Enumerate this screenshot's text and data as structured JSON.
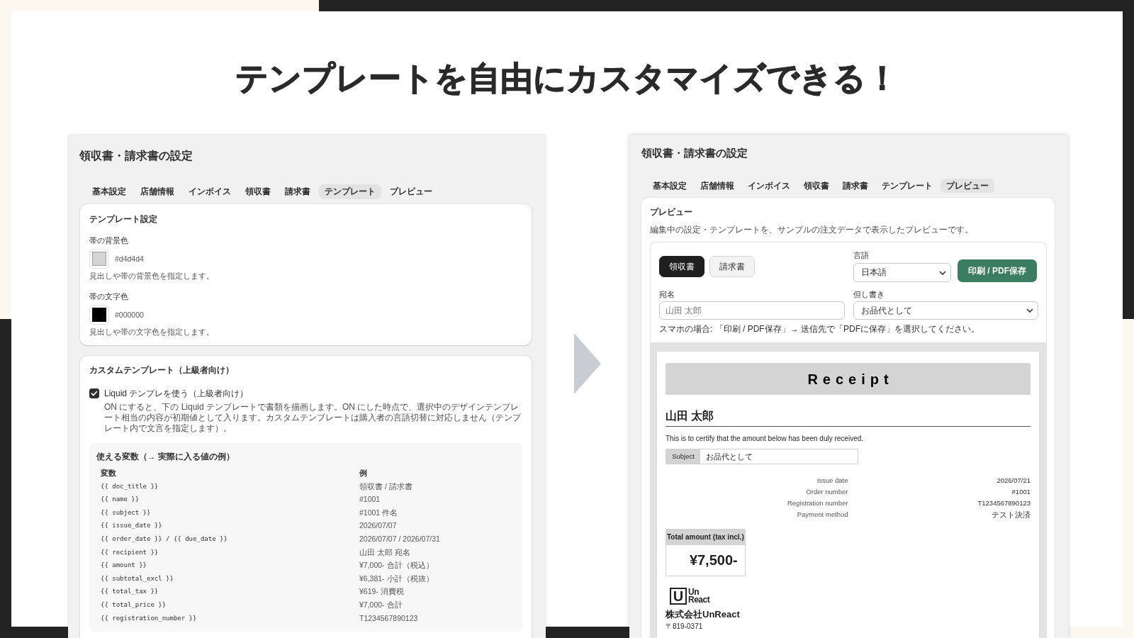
{
  "headline": "テンプレートを自由にカスタマイズできる！",
  "settings_screen": {
    "title": "領収書・請求書の設定",
    "tabs": [
      {
        "label": "基本設定",
        "selected": false
      },
      {
        "label": "店舗情報",
        "selected": false
      },
      {
        "label": "インボイス",
        "selected": false
      },
      {
        "label": "領収書",
        "selected": false
      },
      {
        "label": "請求書",
        "selected": false
      },
      {
        "label": "テンプレート",
        "selected": true
      },
      {
        "label": "プレビュー",
        "selected": false
      }
    ],
    "template_settings": {
      "title": "テンプレート設定",
      "colors": [
        {
          "label": "帯の背景色",
          "value": "#d4d4d4",
          "color": "#d4d4d4",
          "help": "見出しや帯の背景色を指定します。"
        },
        {
          "label": "帯の文字色",
          "value": "#000000",
          "color": "#000000",
          "help": "見出しや帯の文字色を指定します。"
        }
      ]
    },
    "custom_template": {
      "title": "カスタムテンプレート（上級者向け）",
      "checkbox": {
        "label": "Liquid テンプレを使う（上級者向け）",
        "checked": true
      },
      "description": "ON にすると、下の Liquid テンプレートで書類を描画します。ON にした時点で、選択中のデザインテンプレート相当の内容が初期値として入ります。カスタムテンプレートは購入者の言語切替に対応しません（テンプレート内で文言を指定します）。",
      "variables": {
        "title": "使える変数（→ 実際に入る値の例）",
        "columns": [
          "変数",
          "例"
        ],
        "rows": [
          {
            "variable": "{{ doc_title }}",
            "example": "領収書 / 請求書"
          },
          {
            "variable": "{{ name }}",
            "example": "#1001"
          },
          {
            "variable": "{{ subject }}",
            "example": "#1001 件名"
          },
          {
            "variable": "{{ issue_date }}",
            "example": "2026/07/07"
          },
          {
            "variable": "{{ order_date }} / {{ due_date }}",
            "example": "2026/07/07 / 2026/07/31"
          },
          {
            "variable": "{{ recipient }}",
            "example": "山田 太郎 宛名"
          },
          {
            "variable": "{{ amount }}",
            "example": "¥7,000- 合計（税込）"
          },
          {
            "variable": "{{ subtotal_excl }}",
            "example": "¥6,381- 小計（税抜）"
          },
          {
            "variable": "{{ total_tax }}",
            "example": "¥619- 消費税"
          },
          {
            "variable": "{{ total_price }}",
            "example": "¥7,000- 合計"
          },
          {
            "variable": "{{ registration_number }}",
            "example": "T1234567890123"
          }
        ]
      }
    }
  },
  "preview_screen": {
    "title": "領収書・請求書の設定",
    "tabs": [
      {
        "label": "基本設定",
        "selected": false
      },
      {
        "label": "店舗情報",
        "selected": false
      },
      {
        "label": "インボイス",
        "selected": false
      },
      {
        "label": "領収書",
        "selected": false
      },
      {
        "label": "請求書",
        "selected": false
      },
      {
        "label": "テンプレート",
        "selected": false
      },
      {
        "label": "プレビュー",
        "selected": true
      }
    ],
    "preview": {
      "title": "プレビュー",
      "description": "編集中の設定・テンプレートを、サンプルの注文データで表示したプレビューです。",
      "document_types": [
        {
          "label": "領収書",
          "selected": true
        },
        {
          "label": "請求書",
          "selected": false
        }
      ],
      "language": {
        "label": "言語",
        "value": "日本語"
      },
      "print_button": "印刷 / PDF保存",
      "recipient": {
        "label": "宛名",
        "placeholder": "山田 太郎"
      },
      "proviso": {
        "label": "但し書き",
        "value": "お品代として"
      },
      "note": "スマホの場合: 「印刷 / PDF保存」→ 送信先で「PDFに保存」を選択してください。",
      "document": {
        "title": "Receipt",
        "recipient": "山田 太郎",
        "statement": "This is to certify that the amount below has been duly received.",
        "subject": {
          "label": "Subject",
          "value": "お品代として"
        },
        "details": [
          {
            "label": "Issue date",
            "value": "2026/07/21"
          },
          {
            "label": "Order number",
            "value": "#1001"
          },
          {
            "label": "Registration number",
            "value": "T1234567890123"
          },
          {
            "label": "Payment method",
            "value": "テスト決済"
          }
        ],
        "total": {
          "label": "Total amount (tax incl.)",
          "value": "¥7,500-"
        },
        "logo": {
          "mark": "U",
          "lines": [
            "Un",
            "React"
          ]
        },
        "company": "株式会社UnReact",
        "postal_code": "〒819-0371"
      }
    }
  }
}
